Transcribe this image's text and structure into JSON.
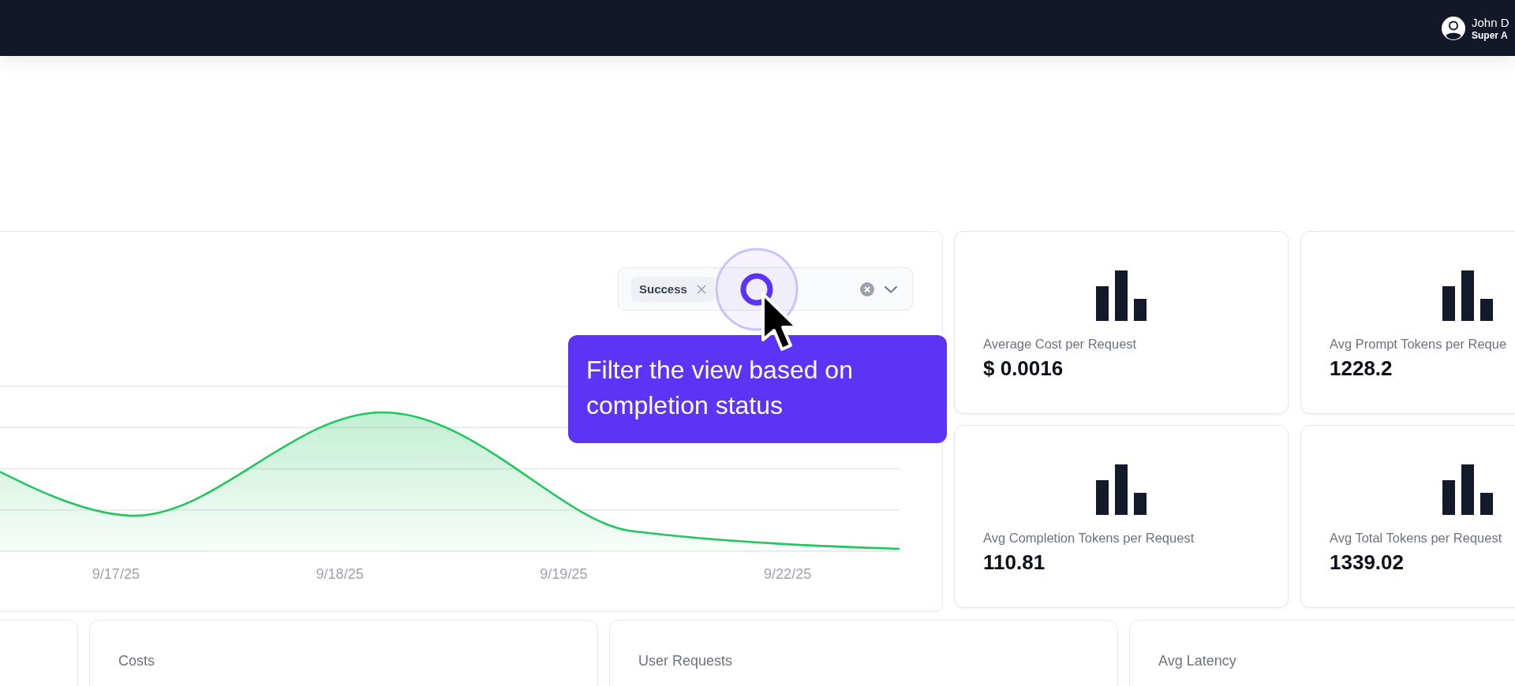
{
  "top_bar": {
    "user": {
      "name": "John D",
      "role": "Super A"
    }
  },
  "chart_card": {
    "filter": {
      "chips": [
        {
          "label": "Success"
        }
      ]
    },
    "x_labels": [
      "9/17/25",
      "9/18/25",
      "9/19/25",
      "9/22/25"
    ]
  },
  "tour_tooltip": {
    "text": "Filter the view based on completion status"
  },
  "stat_cards": [
    {
      "label": "Average Cost per Request",
      "value": "$ 0.0016"
    },
    {
      "label": "Avg Prompt Tokens per Reque",
      "value": "1228.2"
    },
    {
      "label": "Avg Completion Tokens per Request",
      "value": "110.81"
    },
    {
      "label": "Avg Total Tokens per Request",
      "value": "1339.02"
    }
  ],
  "summary_cards": [
    {
      "label": "Costs"
    },
    {
      "label": "User Requests"
    },
    {
      "label": "Avg Latency"
    }
  ]
}
